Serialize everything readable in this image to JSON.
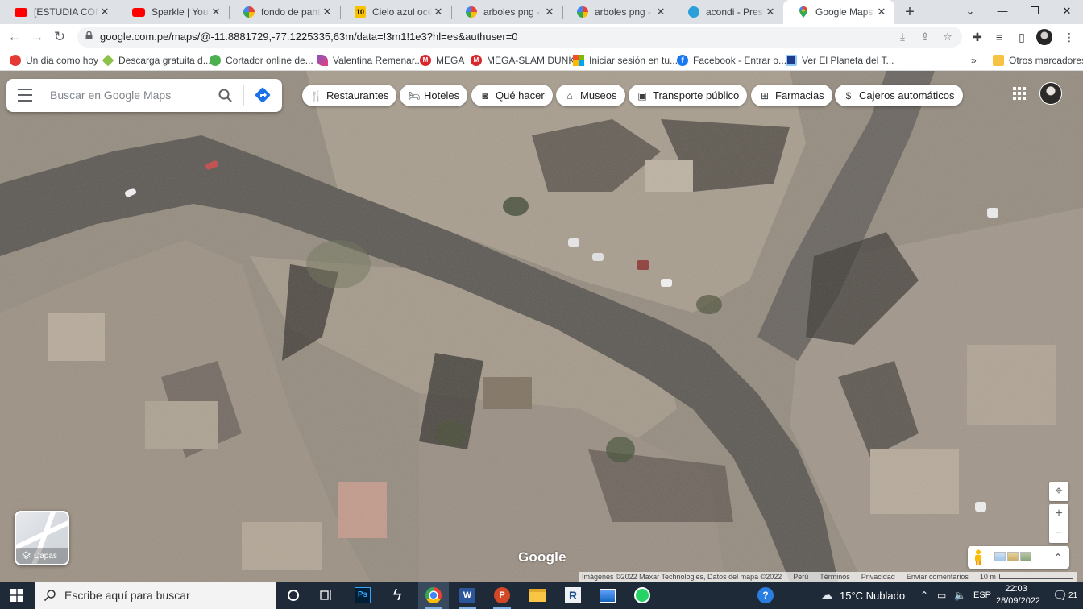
{
  "browser": {
    "tabs": [
      {
        "label": "[ESTUDIA CONMIGO",
        "icon": "youtube-icon"
      },
      {
        "label": "Sparkle | Your Name",
        "icon": "youtube-icon"
      },
      {
        "label": "fondo de pantalla",
        "icon": "google-icon"
      },
      {
        "label": "Cielo azul océano",
        "icon": "site-10-icon"
      },
      {
        "label": "arboles png - Búsqueda",
        "icon": "google-icon"
      },
      {
        "label": "arboles png - Búsqueda",
        "icon": "google-icon"
      },
      {
        "label": "acondi - Presentación",
        "icon": "canva-icon"
      },
      {
        "label": "Google Maps",
        "icon": "maps-pin-icon"
      }
    ],
    "url": "google.com.pe/maps/@-11.8881729,-77.1225335,63m/data=!3m1!1e3?hl=es&authuser=0",
    "bookmarks": [
      {
        "label": "Un dia como hoy",
        "icon": "tomato-icon"
      },
      {
        "label": "Descarga gratuita d...",
        "icon": "gem-icon"
      },
      {
        "label": "Cortador online de...",
        "icon": "gear-icon"
      },
      {
        "label": "Valentina Remenar...",
        "icon": "feather-icon"
      },
      {
        "label": "MEGA",
        "icon": "mega-icon"
      },
      {
        "label": "MEGA-SLAM DUNK",
        "icon": "mega-icon"
      },
      {
        "label": "Iniciar sesión en tu...",
        "icon": "microsoft-icon"
      },
      {
        "label": "Facebook - Entrar o...",
        "icon": "facebook-icon"
      },
      {
        "label": "Ver El Planeta del T...",
        "icon": "monitor-icon"
      }
    ],
    "bookmarks_more": "»",
    "other_bookmarks": "Otros marcadores"
  },
  "maps": {
    "search_placeholder": "Buscar en Google Maps",
    "chips": [
      {
        "label": "Restaurantes",
        "icon": "fork-knife-icon"
      },
      {
        "label": "Hoteles",
        "icon": "bed-icon"
      },
      {
        "label": "Qué hacer",
        "icon": "camera-icon"
      },
      {
        "label": "Museos",
        "icon": "museum-icon"
      },
      {
        "label": "Transporte público",
        "icon": "bus-icon"
      },
      {
        "label": "Farmacias",
        "icon": "pharmacy-icon"
      },
      {
        "label": "Cajeros automáticos",
        "icon": "atm-icon"
      }
    ],
    "layers_label": "Capas",
    "logo": "Google",
    "attribution": "Imágenes ©2022 Maxar Technologies, Datos del mapa ©2022",
    "links": [
      "Perú",
      "Términos",
      "Privacidad",
      "Enviar comentarios"
    ],
    "scale": "10 m"
  },
  "taskbar": {
    "search_placeholder": "Escribe aquí para buscar",
    "weather": "15°C  Nublado",
    "language": "ESP",
    "time": "22:03",
    "date": "28/09/2022",
    "notifications": "21"
  }
}
